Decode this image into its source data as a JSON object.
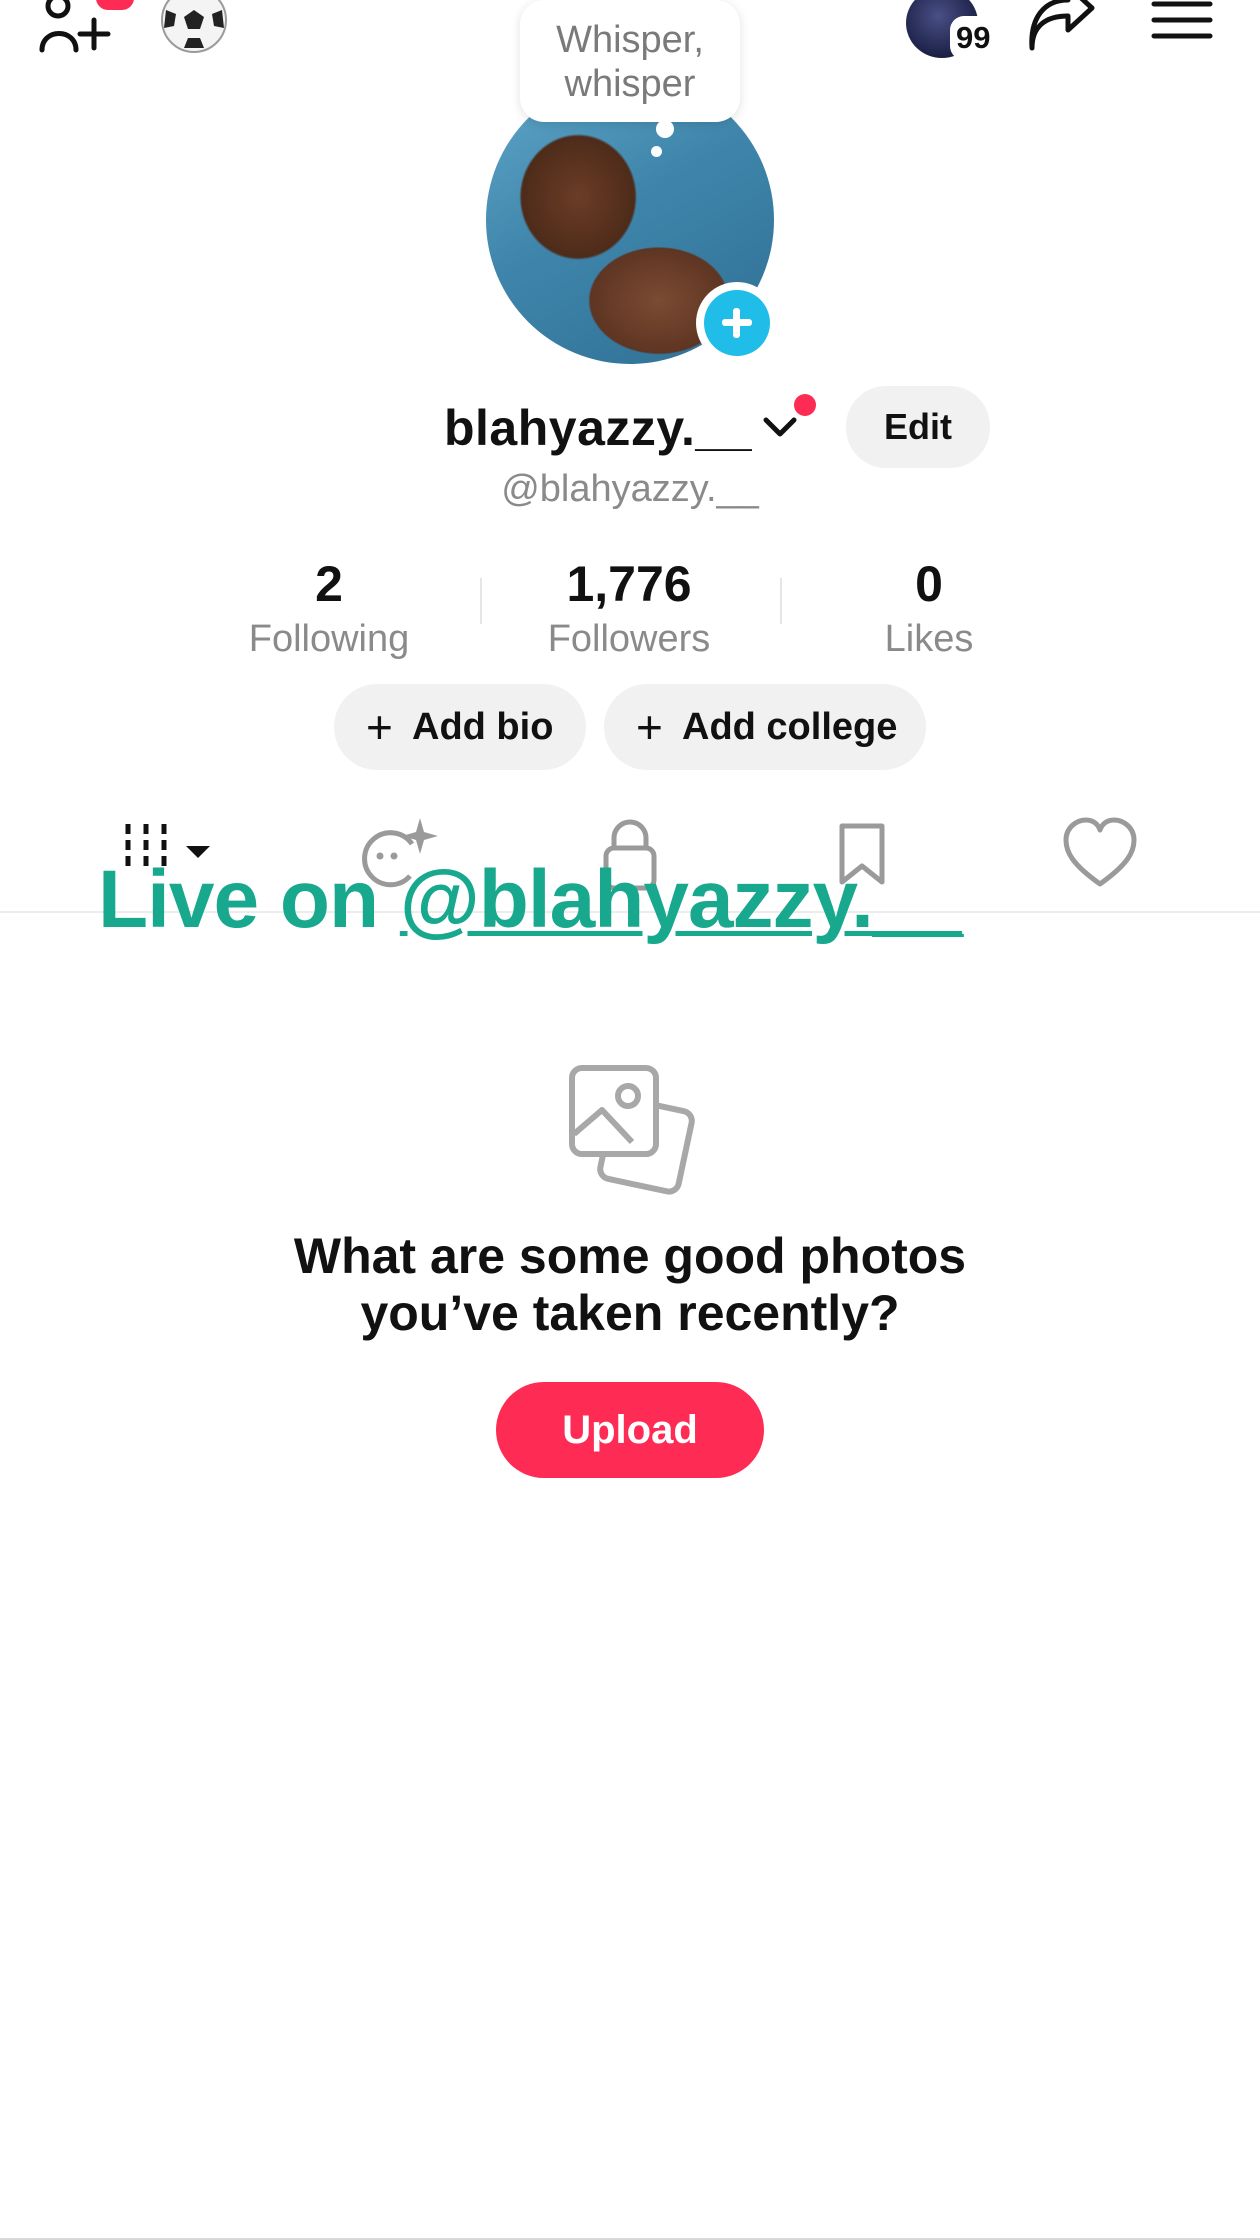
{
  "bubble": {
    "line1": "Whisper,",
    "line2": "whisper"
  },
  "header": {
    "notification_badge": "99"
  },
  "profile": {
    "display_name": "blahyazzy.__",
    "edit_label": "Edit",
    "handle": "@blahyazzy.__"
  },
  "stats": [
    {
      "value": "2",
      "label": "Following"
    },
    {
      "value": "1,776",
      "label": "Followers"
    },
    {
      "value": "0",
      "label": "Likes"
    }
  ],
  "actions": {
    "add_bio": "Add bio",
    "add_college": "Add college"
  },
  "live_overlay": {
    "prefix": "Live on ",
    "handle": "@blahyazzy.__"
  },
  "empty_state": {
    "line1": "What are some good photos",
    "line2": "you’ve taken recently?",
    "upload_label": "Upload"
  },
  "colors": {
    "accent": "#fe2c55",
    "live": "#17a88e",
    "add_avatar": "#20bde8"
  },
  "icons": [
    "add-friend-icon",
    "soccer-ball-icon",
    "share-icon",
    "menu-icon",
    "grid-icon",
    "ai-face-icon",
    "lock-icon",
    "bookmark-icon",
    "heart-icon",
    "photo-icon",
    "chevron-down-icon",
    "plus-icon"
  ]
}
